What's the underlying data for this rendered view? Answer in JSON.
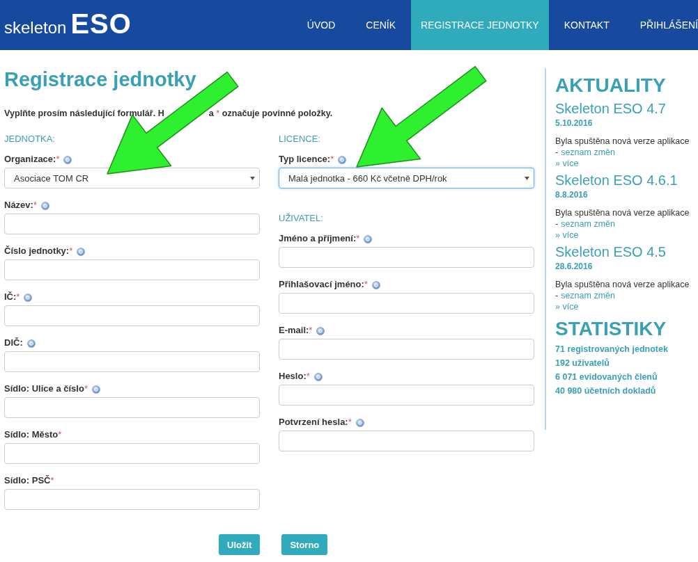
{
  "header": {
    "logo_light": "skeleton",
    "logo_bold": "ESO",
    "nav": [
      {
        "label": "ÚVOD",
        "selected": false
      },
      {
        "label": "CENÍK",
        "selected": false
      },
      {
        "label": "REGISTRACE JEDNOTKY",
        "selected": true
      },
      {
        "label": "KONTAKT",
        "selected": false
      },
      {
        "label": "PŘIHLÁŠENÍ",
        "selected": false
      }
    ]
  },
  "title": "Registrace jednotky",
  "intro": {
    "before": "Vyplňte prosím následující formulář. H",
    "after": "a",
    "mark": "*",
    "rest": "označuje povinné položky."
  },
  "columns": [
    {
      "sections": [
        {
          "heading": "JEDNOTKA:",
          "fields": [
            {
              "label": "Organizace:",
              "mark": "*",
              "help": true,
              "kind": "select",
              "value": "Asociace TOM CR",
              "focused": false
            },
            {
              "label": "Název:",
              "mark": "*",
              "help": true,
              "kind": "text"
            },
            {
              "label": "Číslo jednotky:",
              "mark": "*",
              "help": true,
              "kind": "text"
            },
            {
              "label": "IČ:",
              "mark": "*",
              "help": true,
              "kind": "text"
            },
            {
              "label": "DIČ:",
              "help": true,
              "kind": "text"
            },
            {
              "label": "Sídlo: Ulice a číslo",
              "mark": "*",
              "help": true,
              "kind": "text"
            },
            {
              "label": "Sídlo: Město",
              "mark": "*",
              "help": false,
              "kind": "text"
            },
            {
              "label": "Sídlo: PSČ",
              "mark": "*",
              "help": false,
              "kind": "text"
            }
          ]
        }
      ]
    },
    {
      "sections": [
        {
          "heading": "LICENCE:",
          "fields": [
            {
              "label": "Typ licence:",
              "mark": "*",
              "help": true,
              "kind": "select",
              "value": "Malá jednotka - 660 Kč včetně DPH/rok",
              "focused": true
            }
          ]
        },
        {
          "heading": "UŽIVATEL:",
          "fields": [
            {
              "label": "Jméno a příjmení:",
              "mark": "*",
              "help": true,
              "kind": "text"
            },
            {
              "label": "Přihlašovací jméno:",
              "mark": "*",
              "help": true,
              "kind": "text"
            },
            {
              "label": "E-mail:",
              "mark": "*",
              "help": true,
              "kind": "text"
            },
            {
              "label": "Heslo:",
              "mark": "*",
              "help": true,
              "kind": "text"
            },
            {
              "label": "Potvrzení hesla:",
              "mark": "*",
              "help": true,
              "kind": "text"
            }
          ]
        }
      ]
    }
  ],
  "buttons": [
    {
      "label": "Uložit"
    },
    {
      "label": "Storno"
    }
  ],
  "sidebar": {
    "news_heading": "AKTUALITY",
    "news": [
      {
        "title": "Skeleton ESO 4.7",
        "date": "5.10.2016",
        "text": "Byla spuštěna nová verze aplikace",
        "dash": "-",
        "link": "seznam změn",
        "more": "» více"
      },
      {
        "title": "Skeleton ESO 4.6.1",
        "date": "8.8.2016",
        "text": "Byla spuštěna nová verze aplikace",
        "dash": "-",
        "link": "seznam změn",
        "more": "» více"
      },
      {
        "title": "Skeleton ESO 4.5",
        "date": "28.6.2016",
        "text": "Byla spuštěna nová verze aplikace",
        "dash": "-",
        "link": "seznam změn",
        "more": "» více"
      }
    ],
    "stats_heading": "STATISTIKY",
    "stats": [
      "71 registrovaných jednotek",
      "192 uživatelů",
      "6 071 evidovaných členů",
      "40 980 účetních dokladů"
    ]
  }
}
